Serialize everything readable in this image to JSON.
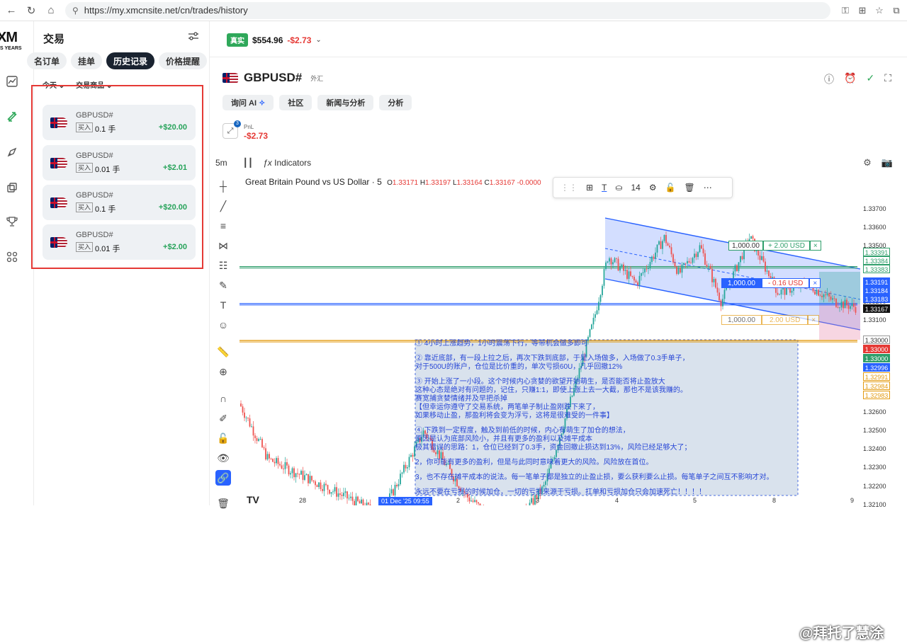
{
  "browser": {
    "url": "https://my.xmcnsite.net/cn/trades/history"
  },
  "rail": {
    "logo": "XM",
    "logo_sub": "S YEARS"
  },
  "panel": {
    "title": "交易",
    "tabs": [
      "名订单",
      "挂单",
      "历史记录",
      "价格提醒"
    ],
    "active_tab": "历史记录",
    "filters": [
      "今天",
      "交易商品"
    ],
    "trades": [
      {
        "symbol": "GBPUSD#",
        "side": "买入",
        "lot": "0.1 手",
        "pnl": "+$20.00"
      },
      {
        "symbol": "GBPUSD#",
        "side": "买入",
        "lot": "0.01 手",
        "pnl": "+$2.01"
      },
      {
        "symbol": "GBPUSD#",
        "side": "买入",
        "lot": "0.1 手",
        "pnl": "+$20.00"
      },
      {
        "symbol": "GBPUSD#",
        "side": "买入",
        "lot": "0.01 手",
        "pnl": "+$2.00"
      }
    ]
  },
  "account": {
    "badge": "真实",
    "balance": "$554.96",
    "change": "-$2.73"
  },
  "instrument": {
    "symbol": "GBPUSD#",
    "category": "外汇",
    "chips": [
      "询问 AI",
      "社区",
      "新闻与分析",
      "分析"
    ],
    "pnl_count": "3",
    "pnl_label": "PnL",
    "pnl_value": "-$2.73"
  },
  "chart_toolbar": {
    "timeframe": "5m",
    "indicators": "Indicators"
  },
  "chart": {
    "title": "Great Britain Pound vs US Dollar · 5",
    "ohlc": [
      {
        "k": "O",
        "v": "1.33171"
      },
      {
        "k": "H",
        "v": "1.33197"
      },
      {
        "k": "L",
        "v": "1.33164"
      },
      {
        "k": "C",
        "v": "1.33167"
      },
      {
        "k": "",
        "v": "-0.0000"
      }
    ],
    "float_toolbar_size": "14",
    "price_labels": [
      "1.33700",
      "1.33600",
      "1.33500",
      "1.33400",
      "1.33300",
      "1.33200",
      "1.33100",
      "1.33000",
      "1.32900",
      "1.32800",
      "1.32700",
      "1.32600",
      "1.32500",
      "1.32400",
      "1.32300",
      "1.32200",
      "1.32100"
    ],
    "tags": [
      {
        "text": "1.33391",
        "color": "#fff",
        "fg": "#2e9e6a",
        "border": "#2e9e6a"
      },
      {
        "text": "1.33384",
        "color": "#fff",
        "fg": "#2e9e6a",
        "border": "#2e9e6a"
      },
      {
        "text": "1.33383",
        "color": "#fff",
        "fg": "#2e9e6a",
        "border": "#2e9e6a"
      },
      {
        "text": "1.33191",
        "color": "#2962ff",
        "fg": "#fff",
        "border": "#2962ff"
      },
      {
        "text": "1.33184",
        "color": "#2962ff",
        "fg": "#fff",
        "border": "#2962ff"
      },
      {
        "text": "1.33183",
        "color": "#2962ff",
        "fg": "#fff",
        "border": "#2962ff"
      },
      {
        "text": "1.33167",
        "color": "#111",
        "fg": "#fff",
        "border": "#111"
      },
      {
        "text": "1.33000",
        "color": "#fff",
        "fg": "#333",
        "border": "#999"
      },
      {
        "text": "1.33000",
        "color": "#e53935",
        "fg": "#fff",
        "border": "#e53935"
      },
      {
        "text": "1.33000",
        "color": "#2e9e6a",
        "fg": "#fff",
        "border": "#2e9e6a"
      },
      {
        "text": "1.32996",
        "color": "#2962ff",
        "fg": "#fff",
        "border": "#2962ff"
      },
      {
        "text": "1.32991",
        "color": "#fff",
        "fg": "#e39b13",
        "border": "#e39b13"
      },
      {
        "text": "1.32984",
        "color": "#fff",
        "fg": "#e39b13",
        "border": "#e39b13"
      },
      {
        "text": "1.32983",
        "color": "#fff",
        "fg": "#e39b13",
        "border": "#e39b13"
      }
    ],
    "time_labels": [
      "28",
      "01 Dec '25  09:55",
      "2",
      "3",
      "4",
      "5",
      "8",
      "9"
    ],
    "order_lines": [
      {
        "lots": "1,000.00",
        "pnl": "+ 2.00 USD",
        "close": "×"
      },
      {
        "lots": "1,000.00",
        "pnl": "- 0.16 USD",
        "close": "×"
      },
      {
        "lots": "1,000.00",
        "pnl": "2.00 USD",
        "close": "×"
      }
    ]
  },
  "notes": [
    "① 4小时上涨趋势，1小时震荡下行，等带机会做多即可",
    "② 靠近底部，有一段上拉之后，再次下跌到底部，于是入场做多，入场做了0.3手单子，\n对于500U的账户，仓位是比价重的，单次亏损60U，几乎回撤12%",
    "③ 开始上涨了一小段。这个时候内心贪婪的欲望开始萌生，是否能否将止盈放大\n这种心态是绝对有问题的，记住，只赚1:1，即使上涨上去一大截，那也不是该我赚的。\n赛宽捕贪婪情绪并及早把杀掉\n【但幸运你遵守了交易系统，两笔单子制止盈刚跌下来了，\n如果移动止盈，那盈利将会变为浮亏，这将是很难受的一件事】",
    "④ 下跌到一定程度，触及到前低的时候，内心有萌生了加仓的想法，\n原因是认为底部风险小，并且有更多的盈利以及摊平成本\n极其错误的思路：1，仓位已经到了0.3手，资金回撤止损达到13%，风险已经足够大了；",
    "2，你可能有更多的盈利，但是与此同时意味着更大的风险。风险放在首位。",
    "3，也不存在摊平成本的说法。每一笔单子都是独立的止盈止损，要么获利要么止损。每笔单子之间互不影响才对。",
    "永远不要在亏损的时候加仓，一切的亏损来源于亏损。扛单和亏损加仓只会加速死亡！！！！"
  ],
  "watermark": "@拜托了慧涂",
  "colors": {
    "accent": "#2962ff",
    "buy": "#2fa85a",
    "loss": "#e53935",
    "highlight": "#e53935"
  }
}
